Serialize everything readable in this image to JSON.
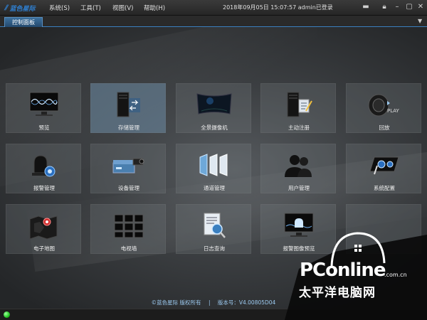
{
  "app": {
    "logo_text": "蓝色星际",
    "menus": [
      "系统(S)",
      "工具(T)",
      "视图(V)",
      "帮助(H)"
    ],
    "status": "2018年09月05日 15:07:57 admin已登录"
  },
  "tabbar": {
    "active_tab": "控制面板"
  },
  "tiles": [
    {
      "label": "预览",
      "icon": "monitor-wave-icon",
      "active": false
    },
    {
      "label": "存储管理",
      "icon": "server-storage-icon",
      "active": true
    },
    {
      "label": "全景摄像机",
      "icon": "panorama-screen-icon",
      "active": false
    },
    {
      "label": "主动注册",
      "icon": "server-register-icon",
      "active": false
    },
    {
      "label": "回放",
      "icon": "film-play-icon",
      "active": false
    },
    {
      "label": "报警管理",
      "icon": "alarm-bell-gear-icon",
      "active": false
    },
    {
      "label": "设备管理",
      "icon": "device-camera-icon",
      "active": false
    },
    {
      "label": "通道管理",
      "icon": "channel-panels-icon",
      "active": false
    },
    {
      "label": "用户管理",
      "icon": "users-icon",
      "active": false
    },
    {
      "label": "系统配置",
      "icon": "system-config-icon",
      "active": false
    },
    {
      "label": "电子地图",
      "icon": "map-pin-icon",
      "active": false
    },
    {
      "label": "电视墙",
      "icon": "video-wall-icon",
      "active": false
    },
    {
      "label": "日志查询",
      "icon": "log-search-icon",
      "active": false
    },
    {
      "label": "报警图像预览",
      "icon": "alarm-image-icon",
      "active": false
    },
    {
      "label": "",
      "icon": "",
      "active": false
    }
  ],
  "footer": {
    "copyright": "©蓝色星际 版权所有",
    "separator": "|",
    "version": "版本号：V4.00805D04"
  },
  "watermark": {
    "brand": "PConline",
    "domain": ".com.cn",
    "cn_name": "太平洋电脑网"
  },
  "colors": {
    "accent": "#3a7fc0",
    "active_tile": "#6e8ca5",
    "status_led": "#22c422"
  }
}
